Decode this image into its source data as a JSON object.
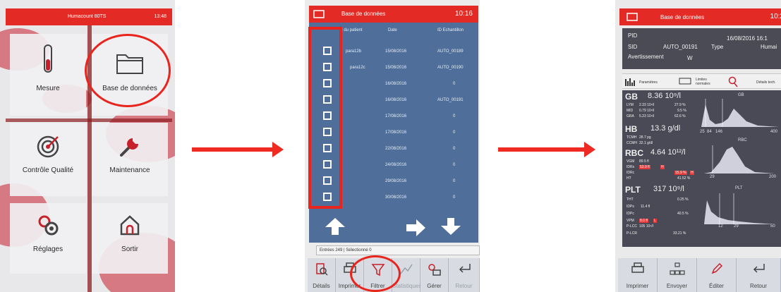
{
  "screen1": {
    "title": "Humacount 80TS",
    "time": "13:48",
    "tiles": {
      "mesure": "Mesure",
      "database": "Base de données",
      "quality": "Contrôle Qualité",
      "maintenance": "Maintenance",
      "settings": "Réglages",
      "exit": "Sortir"
    }
  },
  "screen2": {
    "title": "Base de données",
    "time": "10:16",
    "columns": [
      "I du patient",
      "Date",
      "ID Echantillon"
    ],
    "rows": [
      {
        "patient": "para12b",
        "date": "15/08/2016",
        "sample": "AUTO_00189"
      },
      {
        "patient": "para12c",
        "date": "15/08/2016",
        "sample": "AUTO_00190"
      },
      {
        "patient": "",
        "date": "16/08/2016",
        "sample": "0"
      },
      {
        "patient": "",
        "date": "16/08/2016",
        "sample": "AUTO_00191"
      },
      {
        "patient": "",
        "date": "17/08/2016",
        "sample": "0"
      },
      {
        "patient": "",
        "date": "17/08/2016",
        "sample": "0"
      },
      {
        "patient": "",
        "date": "22/08/2016",
        "sample": "0"
      },
      {
        "patient": "",
        "date": "24/08/2016",
        "sample": "0"
      },
      {
        "patient": "",
        "date": "29/08/2016",
        "sample": "0"
      },
      {
        "patient": "",
        "date": "30/08/2016",
        "sample": "0"
      }
    ],
    "status": "Entrées 249 | Sélectionné 0",
    "buttons": {
      "details": "Détails",
      "print": "Imprimer",
      "filter": "Filtrer",
      "stats": "Statistiques",
      "manage": "Gérer",
      "back": "Retour"
    }
  },
  "screen3": {
    "title": "Base de données",
    "time": "10:2",
    "info": {
      "pid_label": "PID",
      "date": "16/08/2016 16:1",
      "sid_label": "SID",
      "sid": "AUTO_00191",
      "type_label": "Type",
      "type": "Humai",
      "warning_label": "Avertissement",
      "warning": "W"
    },
    "tabs": {
      "params": "Paramètres",
      "limits": "Limites normales",
      "tech": "Détails tech."
    },
    "wbc": {
      "name": "GB",
      "value": "8.36 10⁹/l",
      "lym_label": "LYM",
      "lym": "2.33 10⁹/l",
      "lym_pct": "27.9 %",
      "mid_label": "MID",
      "mid": "0.79 10⁹/l",
      "mid_pct": "9.5 %",
      "gra_label": "GRA",
      "gra": "5.23 10⁹/l",
      "gra_pct": "62.6 %",
      "hist_label": "GB",
      "axis_low": "25",
      "axis_mid": "84",
      "axis_high": "146",
      "axis_end": "400"
    },
    "hb": {
      "name": "HB",
      "value": "13.3 g/dl",
      "tcmh_label": "TCMH",
      "tcmh": "28.7 pg",
      "ccmh_label": "CCMH",
      "ccmh": "32.1 g/dl"
    },
    "rbc": {
      "name": "RBC",
      "value": "4.64 10¹²/l",
      "vgm_label": "VGM",
      "vgm": "89.5 fl",
      "idrs_label": "IDRs",
      "idrs": "53.9 fl",
      "idrs_flag": "H",
      "idrc_label": "IDRc",
      "idrc": "15.9 %",
      "idrc_flag": "H",
      "ht_label": "HT",
      "ht": "41.52 %",
      "hist_label": "RBC",
      "axis_low": "29",
      "axis_end": "200"
    },
    "plt": {
      "name": "PLT",
      "value": "317 10⁹/l",
      "tht_label": "THT",
      "tht": "0.25 %",
      "idps_label": "IDPs",
      "idps": "11.4 fl",
      "idpc_label": "IDPc",
      "idpc": "40.5 %",
      "vpm_label": "VPM",
      "vpm": "8.0 fl",
      "vpm_flag": "L",
      "plcc_label": "P-LCC",
      "plcc": "105 10⁹/l",
      "plcr_label": "P-LCR",
      "plcr": "33.21 %",
      "hist_label": "PLT",
      "axis_low": "12",
      "axis_mid": "29",
      "axis_end": "50"
    },
    "buttons": {
      "print": "Imprimer",
      "send": "Envoyer",
      "edit": "Éditer",
      "back": "Retour"
    }
  }
}
